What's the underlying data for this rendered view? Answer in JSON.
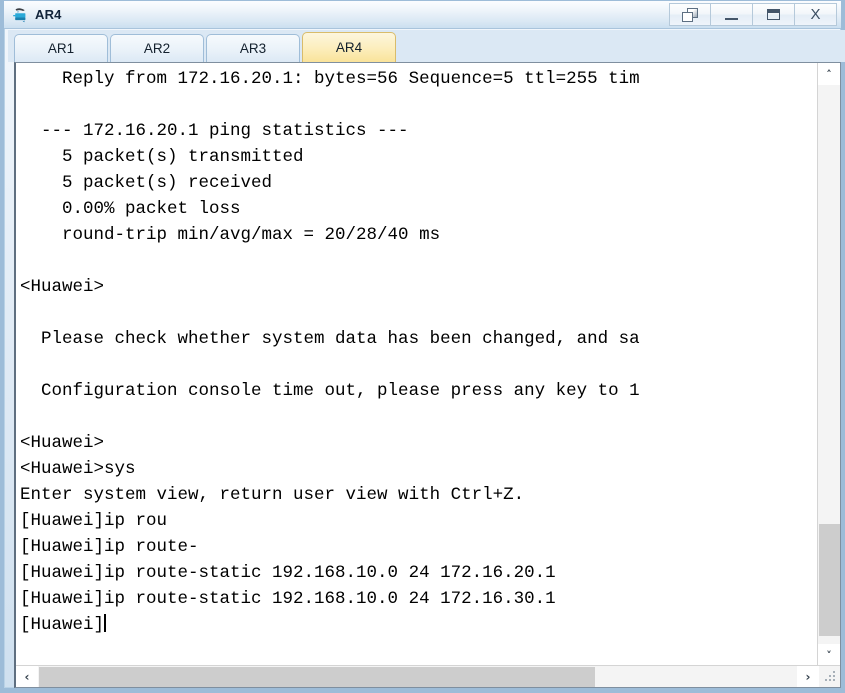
{
  "window": {
    "title": "AR4",
    "icon": "router-icon",
    "controls": [
      {
        "name": "restore-down-button",
        "label": "",
        "icon": "restore-icon"
      },
      {
        "name": "minimize-button",
        "label": "",
        "icon": "minimize-icon"
      },
      {
        "name": "maximize-button",
        "label": "",
        "icon": "maximize-icon"
      },
      {
        "name": "close-button",
        "label": "X",
        "icon": "close-icon"
      }
    ]
  },
  "tabs": {
    "items": [
      {
        "label": "AR1",
        "active": false
      },
      {
        "label": "AR2",
        "active": false
      },
      {
        "label": "AR3",
        "active": false
      },
      {
        "label": "AR4",
        "active": true
      }
    ],
    "active_index": 3
  },
  "terminal": {
    "lines": [
      "    Reply from 172.16.20.1: bytes=56 Sequence=5 ttl=255 tim",
      "",
      "  --- 172.16.20.1 ping statistics ---",
      "    5 packet(s) transmitted",
      "    5 packet(s) received",
      "    0.00% packet loss",
      "    round-trip min/avg/max = 20/28/40 ms",
      "",
      "<Huawei>",
      "",
      "  Please check whether system data has been changed, and sa",
      "",
      "  Configuration console time out, please press any key to 1",
      "",
      "<Huawei>",
      "<Huawei>sys",
      "Enter system view, return user view with Ctrl+Z.",
      "[Huawei]ip rou",
      "[Huawei]ip route-",
      "[Huawei]ip route-static 192.168.10.0 24 172.16.20.1",
      "[Huawei]ip route-static 192.168.10.0 24 172.16.30.1"
    ],
    "prompt_line": "[Huawei]",
    "cursor_visible": true
  },
  "scrollbars": {
    "vertical": {
      "up_arrow": "˄",
      "down_arrow": "˅"
    },
    "horizontal": {
      "left_arrow": "‹",
      "right_arrow": "›"
    }
  },
  "colors": {
    "active_tab": "#fae39a",
    "title_bar": "#dae8f4",
    "frame": "#9dbcd8",
    "terminal_bg": "#ffffff",
    "terminal_fg": "#000000",
    "scroll_thumb": "#cdcdcd"
  }
}
